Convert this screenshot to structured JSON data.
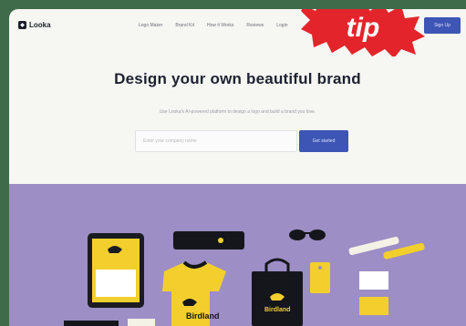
{
  "header": {
    "logo_text": "Looka",
    "menu": [
      "Logo Maker",
      "Brand Kit",
      "How it Works",
      "Reviews",
      "Login"
    ],
    "signup_label": "Sign Up"
  },
  "badge": {
    "text": "tip",
    "color": "#e3252b"
  },
  "hero": {
    "headline": "Design your own beautiful brand",
    "subheadline": "Use Looka's AI-powered platform to design a logo and build a brand you love.",
    "email_placeholder": "Enter your company name",
    "cta_label": "Get started"
  },
  "showcase": {
    "brand_name": "Birdland",
    "background": "#9d8ec5",
    "accent": "#f2cf2d"
  },
  "colors": {
    "primary": "#3d55b5",
    "frame_bg": "#3f6b4a"
  }
}
